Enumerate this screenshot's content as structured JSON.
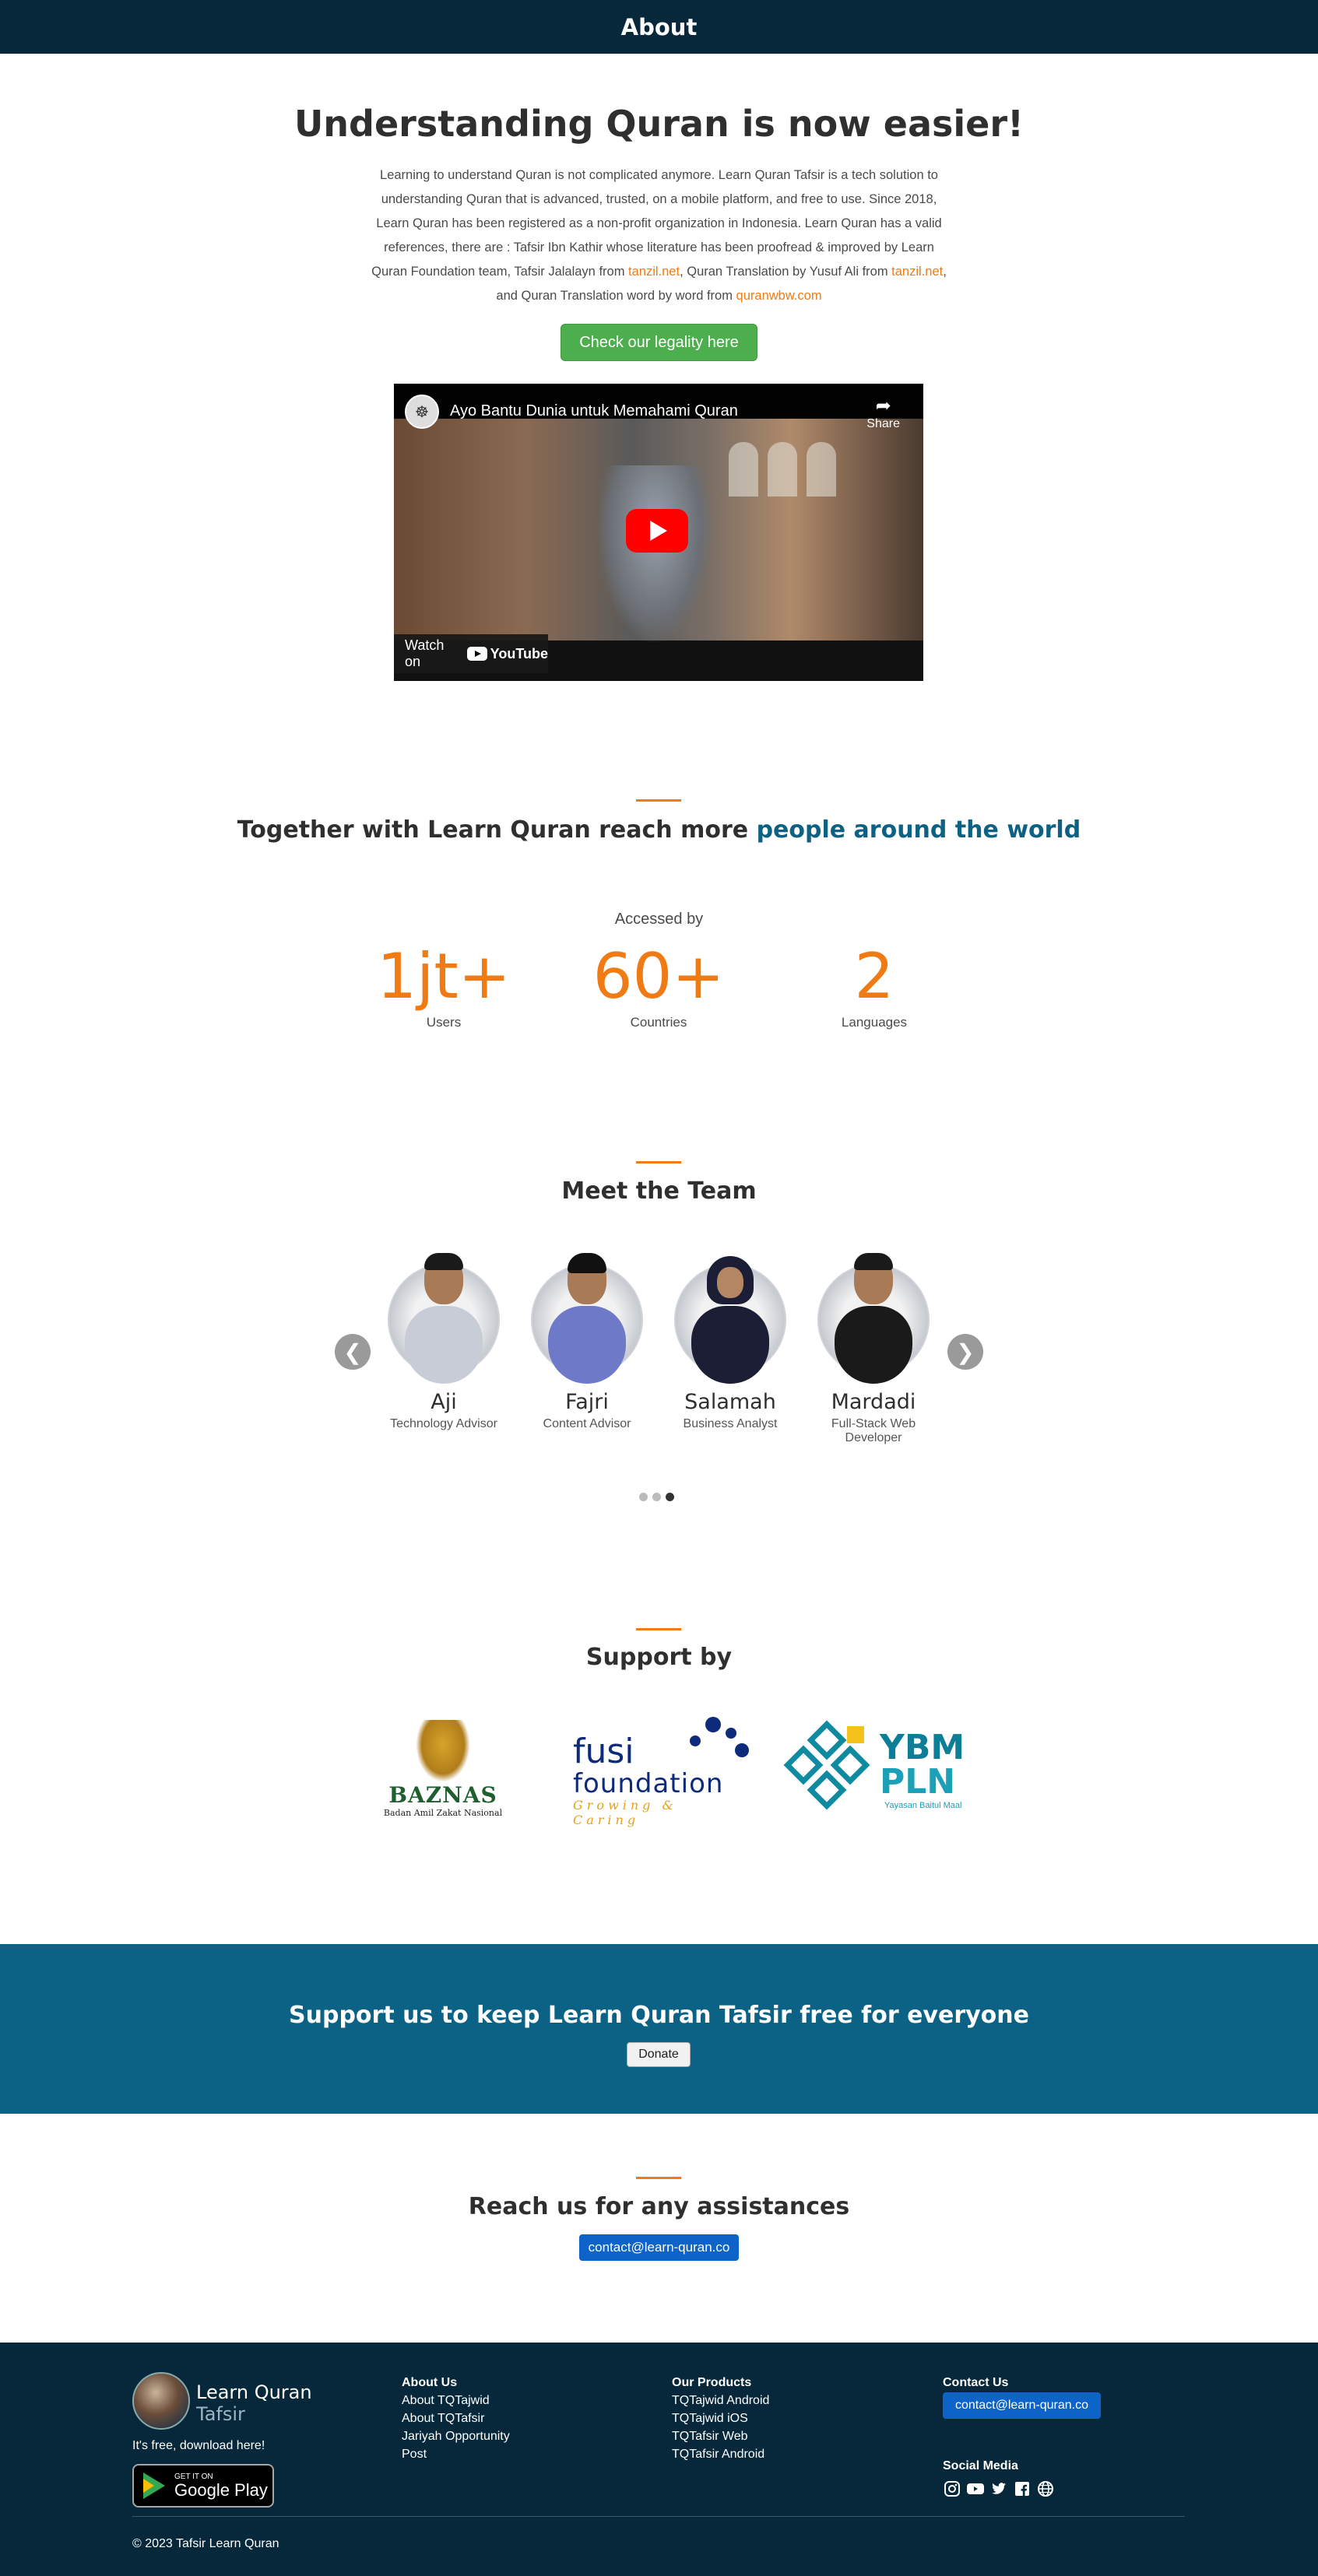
{
  "topbar": {
    "title": "About"
  },
  "hero": {
    "title": "Understanding Quran is now easier!",
    "text_1": "Learning to understand Quran is not complicated anymore. Learn Quran Tafsir is a tech solution to understanding Quran that is advanced, trusted, on a mobile platform, and free to use. Since 2018, Learn Quran has been registered as a non-profit organization in Indonesia. Learn Quran has a valid references, there are : Tafsir Ibn Kathir whose literature has been proofread & improved by Learn Quran Foundation team, Tafsir Jalalayn from ",
    "link_1": "tanzil.net",
    "text_2": ", Quran Translation by Yusuf Ali from ",
    "link_2": "tanzil.net",
    "text_3": ", and Quran Translation word by word from ",
    "link_3": "quranwbw.com",
    "legal_button": "Check our legality here"
  },
  "video": {
    "title": "Ayo Bantu Dunia untuk Memahami Quran",
    "share_label": "Share",
    "watch_label": "Watch on",
    "youtube_label": "YouTube"
  },
  "reach": {
    "title_prefix": "Together with Learn Quran reach more ",
    "title_highlight": "people around the world",
    "accessed_label": "Accessed by",
    "stats": [
      {
        "value": "1jt+",
        "label": "Users"
      },
      {
        "value": "60+",
        "label": "Countries"
      },
      {
        "value": "2",
        "label": "Languages"
      }
    ]
  },
  "team": {
    "title": "Meet the Team",
    "prev_icon": "❮",
    "next_icon": "❯",
    "members": [
      {
        "name": "Aji",
        "role": "Technology Advisor"
      },
      {
        "name": "Fajri",
        "role": "Content Advisor"
      },
      {
        "name": "Salamah",
        "role": "Business Analyst"
      },
      {
        "name": "Mardadi",
        "role": "Full-Stack Web Developer"
      }
    ],
    "active_dot": 3
  },
  "support": {
    "title": "Support by",
    "baznas_word": "BAZNAS",
    "baznas_sub": "Badan Amil Zakat Nasional",
    "fusi_1": "fusi",
    "fusi_2": "foundation",
    "fusi_3": "Growing & Caring",
    "ybm_1": "YBM",
    "ybm_2": "PLN",
    "ybm_3": "Yayasan Baitul Maal"
  },
  "band": {
    "title": "Support us to keep Learn Quran Tafsir free for everyone",
    "donate_label": "Donate"
  },
  "assist": {
    "title": "Reach us for any assistances",
    "email": "contact@learn-quran.co"
  },
  "footer": {
    "brand_1": "Learn Quran",
    "brand_2": "Tafsir",
    "free_text": "It's free, download here!",
    "gplay_small": "GET IT ON",
    "gplay_big": "Google Play",
    "about_heading": "About Us",
    "about_links": [
      "About TQTajwid",
      "About TQTafsir",
      "Jariyah Opportunity",
      "Post"
    ],
    "products_heading": "Our Products",
    "products_links": [
      "TQTajwid Android",
      "TQTajwid iOS",
      "TQTafsir Web",
      "TQTafsir Android"
    ],
    "contact_heading": "Contact Us",
    "contact_email": "contact@learn-quran.co",
    "social_heading": "Social Media",
    "social_icons": [
      "instagram-icon",
      "youtube-icon",
      "twitter-icon",
      "facebook-icon",
      "globe-icon"
    ],
    "copyright": "© 2023 Tafsir Learn Quran"
  },
  "colors": {
    "navy": "#06283a",
    "accent_orange": "#f07a14",
    "teal": "#0b6285",
    "green_button": "#4cae4c",
    "blue_button": "#0e63c9"
  }
}
